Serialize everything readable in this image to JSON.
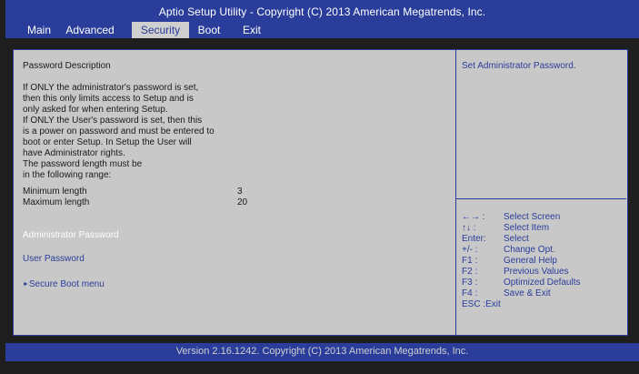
{
  "header": {
    "title": "Aptio Setup Utility - Copyright (C) 2013 American Megatrends, Inc.",
    "tabs": [
      {
        "label": "Main"
      },
      {
        "label": "Advanced"
      },
      {
        "label": "Security"
      },
      {
        "label": "Boot"
      },
      {
        "label": "Exit"
      }
    ],
    "active_tab": "Security"
  },
  "left_panel": {
    "heading": "Password Description",
    "description": [
      "If ONLY the administrator's password is set,",
      "then this only limits access to Setup and is",
      "only asked for when entering Setup.",
      "If ONLY the User's password is set, then this",
      "is a power on password and must be entered to",
      "boot or enter Setup.  In Setup the User will",
      "have Administrator rights.",
      "The password length must be",
      "in the following range:"
    ],
    "min_length_label": "Minimum length",
    "min_length_value": "3",
    "max_length_label": "Maximum length",
    "max_length_value": "20",
    "items": [
      {
        "label": "Administrator Password"
      },
      {
        "label": "User Password"
      },
      {
        "label": "Secure Boot menu"
      }
    ],
    "submenu_arrow": "►"
  },
  "right_panel": {
    "help": "Set Administrator Password.",
    "keys": [
      {
        "key": "←→ :",
        "action": "Select Screen"
      },
      {
        "key": "↑↓  :",
        "action": "Select Item"
      },
      {
        "key": "Enter:",
        "action": "Select"
      },
      {
        "key": "+/-  :",
        "action": "Change Opt."
      },
      {
        "key": "F1 :",
        "action": "General Help"
      },
      {
        "key": "F2 :",
        "action": "Previous Values"
      },
      {
        "key": "F3 :",
        "action": "Optimized Defaults"
      },
      {
        "key": "F4 :",
        "action": "Save & Exit"
      },
      {
        "key": "ESC :Exit",
        "action": ""
      }
    ]
  },
  "footer": {
    "text": "Version 2.16.1242. Copyright (C) 2013 American Megatrends, Inc."
  },
  "colors": {
    "bar_blue": "#2a3d9a",
    "panel_gray": "#c8c8c8",
    "selected_text": "#ffffff"
  }
}
